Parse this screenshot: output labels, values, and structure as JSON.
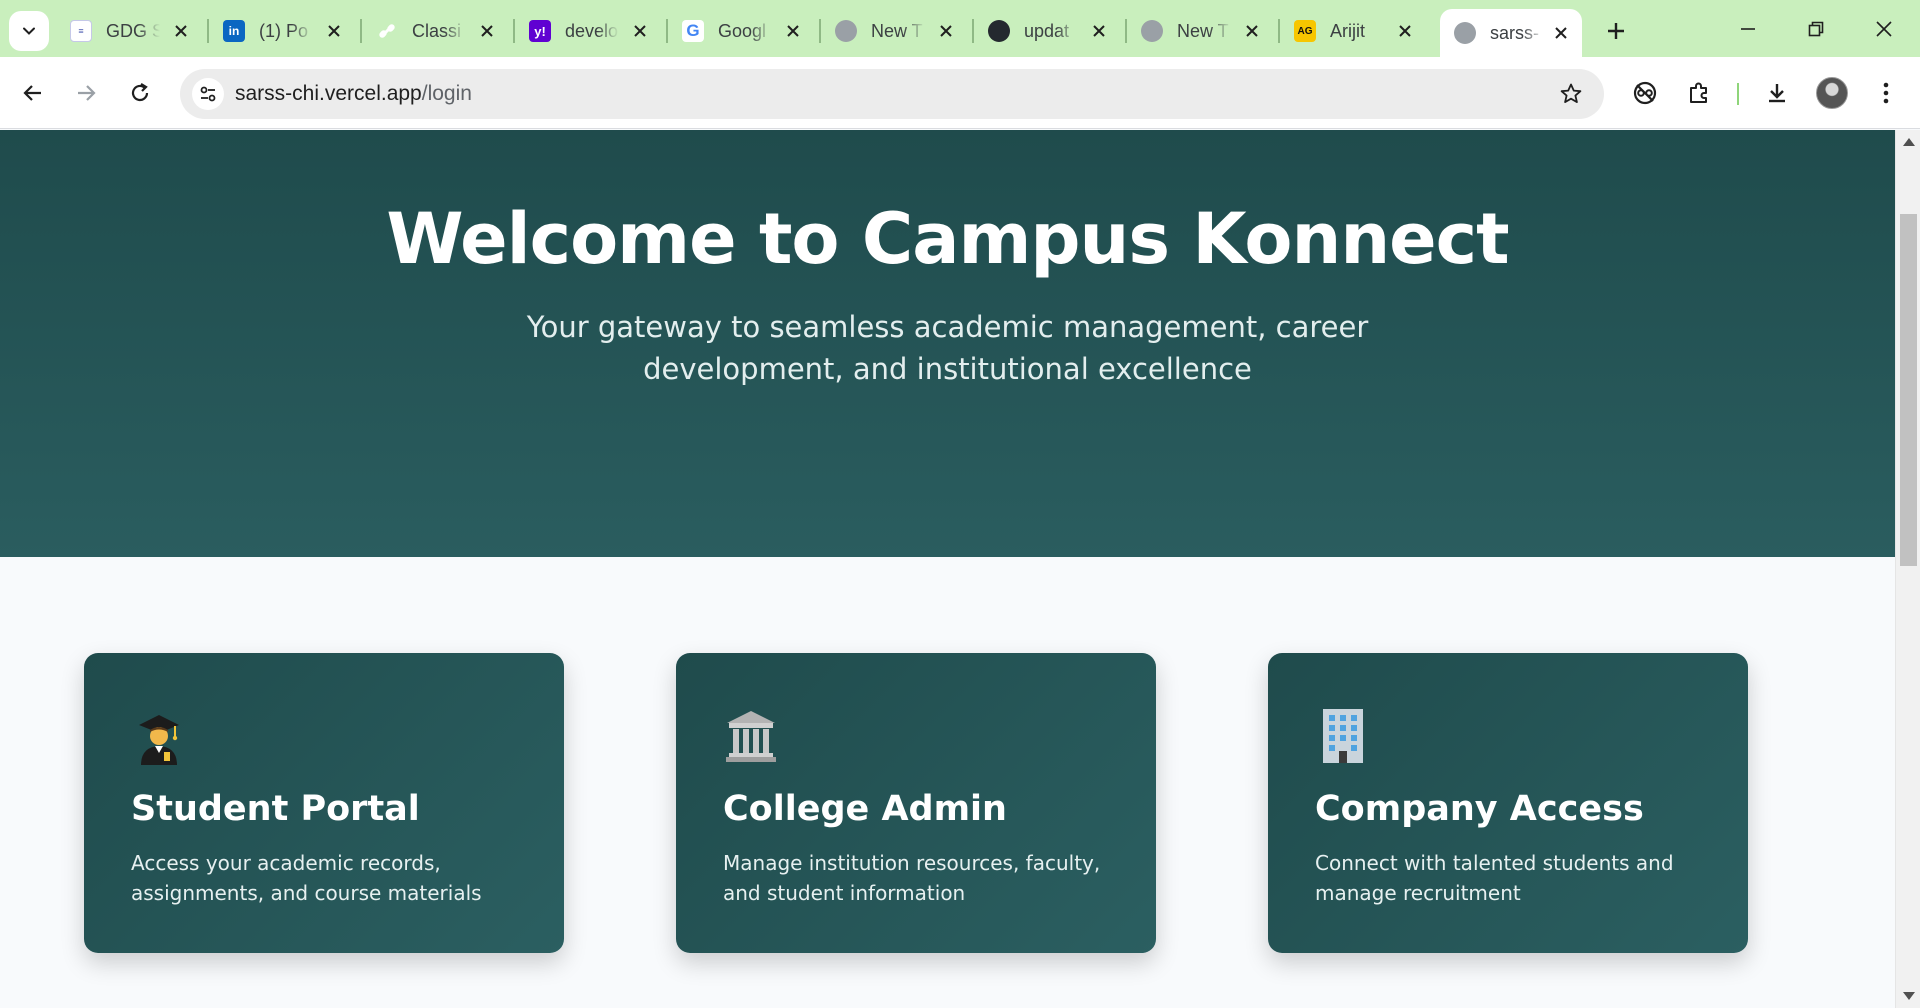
{
  "browser": {
    "tabs": [
      {
        "title": "GDG S",
        "icon": "gdg-icon",
        "color": "#4a5ab0"
      },
      {
        "title": "(1) Po",
        "icon": "linkedin-icon",
        "color": "#0a66c2"
      },
      {
        "title": "Classi",
        "icon": "link-icon",
        "color": "#5f6368"
      },
      {
        "title": "develo",
        "icon": "yahoo-icon",
        "color": "#6001d2"
      },
      {
        "title": "Googl",
        "icon": "google-icon",
        "color": "#4285f4"
      },
      {
        "title": "New T",
        "icon": "globe-icon",
        "color": "#9aa0a6"
      },
      {
        "title": "updat",
        "icon": "github-icon",
        "color": "#24292f"
      },
      {
        "title": "New T",
        "icon": "globe-icon",
        "color": "#9aa0a6"
      },
      {
        "title": "Arijit",
        "icon": "ag-icon",
        "color": "#f7c600"
      },
      {
        "title": "sarss-",
        "icon": "globe-icon",
        "color": "#9aa0a6",
        "active": true
      }
    ],
    "url_host": "sarss-chi.vercel.app",
    "url_path": "/login"
  },
  "hero": {
    "title": "Welcome to Campus Konnect",
    "subtitle": "Your gateway to seamless academic management, career development, and institutional excellence"
  },
  "cards": [
    {
      "icon": "graduate-icon",
      "title": "Student Portal",
      "description": "Access your academic records, assignments, and course materials"
    },
    {
      "icon": "classical-building-icon",
      "title": "College Admin",
      "description": "Manage institution resources, faculty, and student information"
    },
    {
      "icon": "office-building-icon",
      "title": "Company Access",
      "description": "Connect with talented students and manage recruitment"
    }
  ],
  "colors": {
    "tabbar": "#c9efbd",
    "hero_top": "#1f4b4c",
    "hero_bottom": "#2a5d5f",
    "card_bg": "#245355",
    "page_bg": "#f8fafc"
  }
}
